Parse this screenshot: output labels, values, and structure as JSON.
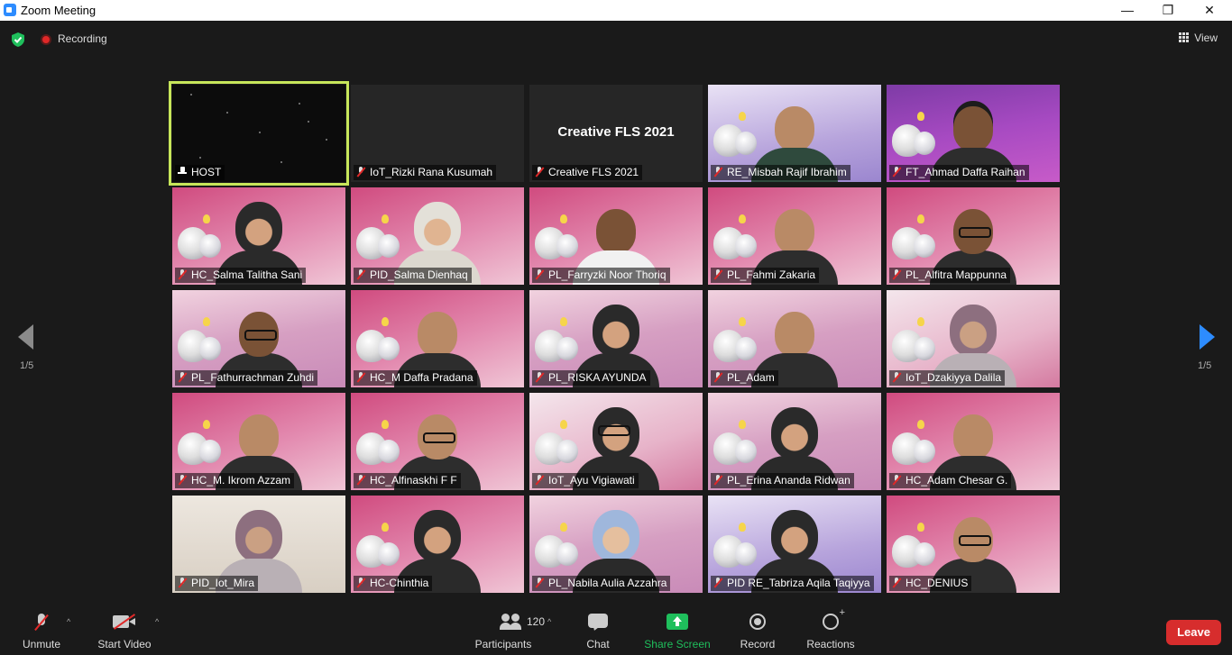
{
  "window": {
    "title": "Zoom Meeting",
    "minimize_glyph": "—",
    "restore_glyph": "❐",
    "close_glyph": "✕"
  },
  "topbar": {
    "recording_label": "Recording",
    "view_label": "View",
    "security_color": "#1fbf5c"
  },
  "pagination": {
    "left": "1/5",
    "right": "1/5"
  },
  "tiles": [
    {
      "name": "HOST",
      "style": "host"
    },
    {
      "name": "IoT_Rizki Rana Kusumah",
      "style": "gray"
    },
    {
      "name": "Creative FLS 2021",
      "style": "gray",
      "center_text": "Creative FLS 2021"
    },
    {
      "name": "RE_Misbah Rajif Ibrahim",
      "style": "lav"
    },
    {
      "name": "FT_Ahmad Daffa Raihan",
      "style": "purp"
    },
    {
      "name": "HC_Salma Talitha Sani",
      "style": "pink"
    },
    {
      "name": "PID_Salma Dienhaq",
      "style": "pink"
    },
    {
      "name": "PL_Farryzki Noor Thoriq",
      "style": "pink"
    },
    {
      "name": "PL_Fahmi Zakaria",
      "style": "pink"
    },
    {
      "name": "PL_Alfitra Mappunna",
      "style": "pink"
    },
    {
      "name": "PL_Fathurrachman Zuhdi",
      "style": "grad"
    },
    {
      "name": "HC_M Daffa Pradana",
      "style": "pink"
    },
    {
      "name": "PL_RISKA AYUNDA",
      "style": "grad"
    },
    {
      "name": "PL_Adam",
      "style": "grad"
    },
    {
      "name": "IoT_Dzakiyya Dalila",
      "style": "room"
    },
    {
      "name": "HC_M. Ikrom Azzam",
      "style": "pink"
    },
    {
      "name": "HC_Alfinaskhi F F",
      "style": "pink"
    },
    {
      "name": "IoT_Ayu Vigiawati",
      "style": "room"
    },
    {
      "name": "PL_Erina Ananda Ridwan",
      "style": "grad"
    },
    {
      "name": "HC_Adam Chesar G.",
      "style": "pink"
    },
    {
      "name": "PID_Iot_Mira",
      "style": "wall"
    },
    {
      "name": "HC-Chinthia",
      "style": "pink"
    },
    {
      "name": "PL_Nabila Aulia Azzahra",
      "style": "grad"
    },
    {
      "name": "PID RE_Tabriza Aqila Taqiyya",
      "style": "lav"
    },
    {
      "name": "HC_DENIUS",
      "style": "pink"
    }
  ],
  "toolbar": {
    "unmute": "Unmute",
    "start_video": "Start Video",
    "participants": "Participants",
    "participants_count": "120",
    "chat": "Chat",
    "share_screen": "Share Screen",
    "record": "Record",
    "reactions": "Reactions",
    "leave": "Leave",
    "caret": "^"
  },
  "colors": {
    "accent": "#2d8cff",
    "share_green": "#1fbf5c",
    "leave_red": "#d72d2d",
    "speaker_outline": "#c7e65a"
  }
}
